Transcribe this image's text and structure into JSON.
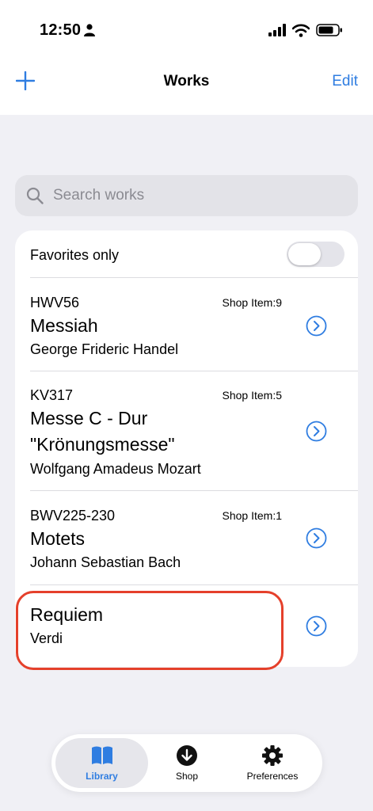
{
  "status_bar": {
    "time": "12:50"
  },
  "nav": {
    "title": "Works",
    "edit_label": "Edit"
  },
  "search": {
    "placeholder": "Search works",
    "value": ""
  },
  "filter": {
    "favorites_label": "Favorites only",
    "favorites_on": false
  },
  "works": [
    {
      "code": "HWV56",
      "shop": "Shop Item:9",
      "title": "Messiah",
      "composer": "George Frideric Handel"
    },
    {
      "code": "KV317",
      "shop": "Shop Item:5",
      "title": "Messe C - Dur \"Krönungsmesse\"",
      "composer": "Wolfgang Amadeus Mozart"
    },
    {
      "code": "BWV225-230",
      "shop": "Shop Item:1",
      "title": "Motets",
      "composer": "Johann Sebastian Bach"
    },
    {
      "code": "",
      "shop": "",
      "title": "Requiem",
      "composer": "Verdi"
    }
  ],
  "tabs": [
    {
      "label": "Library",
      "icon": "book-icon",
      "active": true
    },
    {
      "label": "Shop",
      "icon": "download-icon",
      "active": false
    },
    {
      "label": "Preferences",
      "icon": "gear-icon",
      "active": false
    }
  ],
  "colors": {
    "accent": "#2f7de1",
    "highlight": "#e5402b",
    "background": "#f0f0f5"
  }
}
